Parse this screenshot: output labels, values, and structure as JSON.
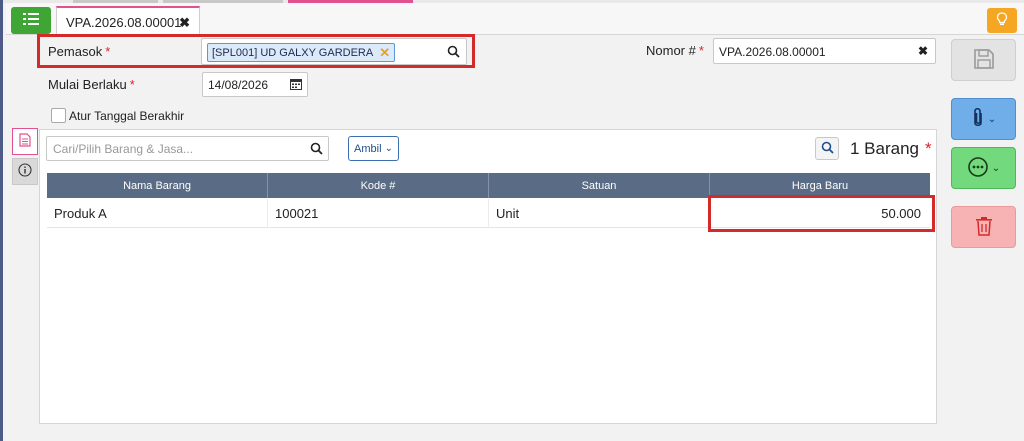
{
  "tabs": [
    {
      "label": "VPA.2026.08.00001"
    }
  ],
  "form": {
    "supplier_label": "Pemasok",
    "supplier_value": "[SPL001] UD GALXY GARDERA",
    "start_label": "Mulai Berlaku",
    "start_value": "14/08/2026",
    "end_date_label": "Atur Tanggal Berakhir",
    "number_label": "Nomor #",
    "number_value": "VPA.2026.08.00001",
    "required_mark": "*"
  },
  "items": {
    "search_placeholder": "Cari/Pilih Barang & Jasa...",
    "take_button": "Ambil",
    "count_text": "1 Barang",
    "columns": [
      "Nama Barang",
      "Kode #",
      "Satuan",
      "Harga Baru"
    ],
    "rows": [
      {
        "name": "Produk A",
        "code": "100021",
        "unit": "Unit",
        "price": "50.000"
      }
    ]
  },
  "colors": {
    "accent_green": "#3fa535",
    "accent_blue": "#5b9bd5",
    "danger": "#d32a2a",
    "header": "#5a6b85"
  },
  "icons": {
    "menu": "list-icon",
    "bulb": "lightbulb-icon",
    "save": "save-icon",
    "attach": "paperclip-icon",
    "more": "more-icon",
    "delete": "trash-icon",
    "search": "search-icon",
    "calendar": "calendar-icon"
  }
}
